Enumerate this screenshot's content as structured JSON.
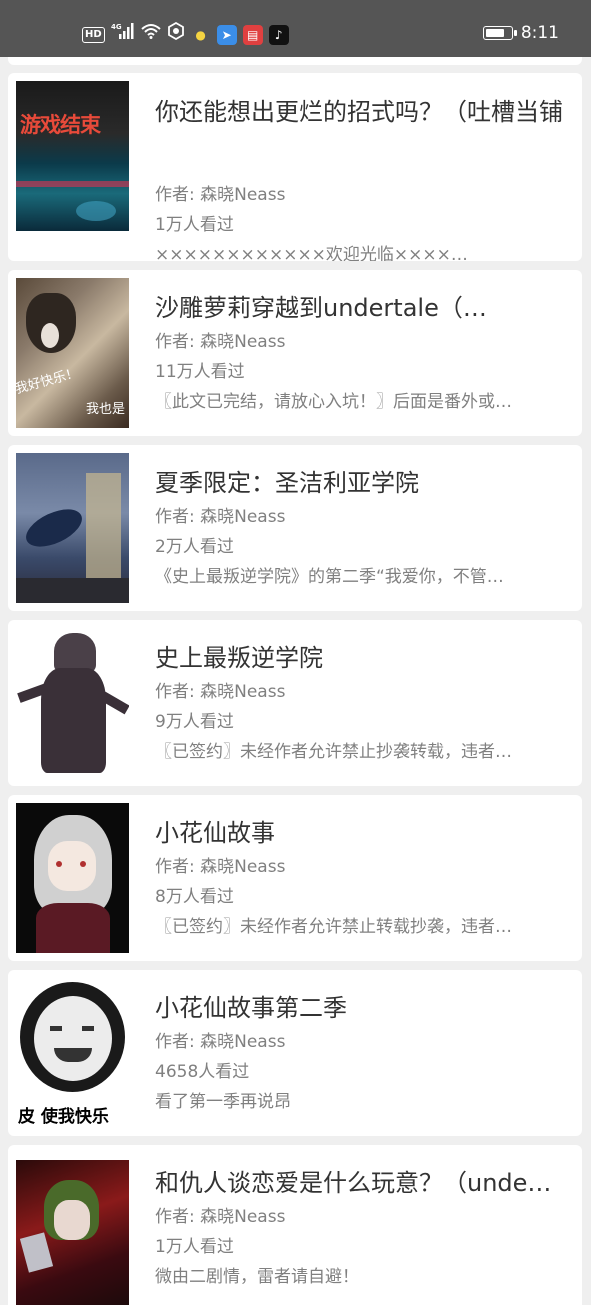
{
  "status_bar": {
    "network": "4G",
    "hd": "HD",
    "time": "8:11",
    "battery_level": 0.8,
    "icons": [
      "hd-icon",
      "signal-icon",
      "wifi-icon",
      "shield-icon",
      "bulb-icon",
      "send-app-icon",
      "book-app-icon",
      "tiktok-app-icon"
    ]
  },
  "books": [
    {
      "title": "你还能想出更烂的招式吗？（吐槽当铺",
      "author": "作者: 森晓Neass",
      "views": "1万人看过",
      "description": "××××××××××××欢迎光临××××…",
      "cover_text": "游戏结束"
    },
    {
      "title": "沙雕萝莉穿越到undertale（…",
      "author": "作者: 森晓Neass",
      "views": "11万人看过",
      "description": "〖此文已完结，请放心入坑！〗后面是番外或…",
      "cover_text": "我好快乐！",
      "cover_text_2": "我也是"
    },
    {
      "title": "夏季限定：圣洁利亚学院",
      "author": "作者: 森晓Neass",
      "views": "2万人看过",
      "description": "《史上最叛逆学院》的第二季“我爱你，不管…"
    },
    {
      "title": "史上最叛逆学院",
      "author": "作者: 森晓Neass",
      "views": "9万人看过",
      "description": "〖已签约〗未经作者允许禁止抄袭转载，违者…"
    },
    {
      "title": "小花仙故事",
      "author": "作者: 森晓Neass",
      "views": "8万人看过",
      "description": "〖已签约〗未经作者允许禁止转载抄袭，违者…"
    },
    {
      "title": "小花仙故事第二季",
      "author": "作者: 森晓Neass",
      "views": "4658人看过",
      "description": "看了第一季再说昂",
      "cover_text": "皮 使我快乐"
    },
    {
      "title": "和仇人谈恋爱是什么玩意？（unde…",
      "author": "作者: 森晓Neass",
      "views": "1万人看过",
      "description": "微由二剧情，雷者请自避！"
    }
  ]
}
